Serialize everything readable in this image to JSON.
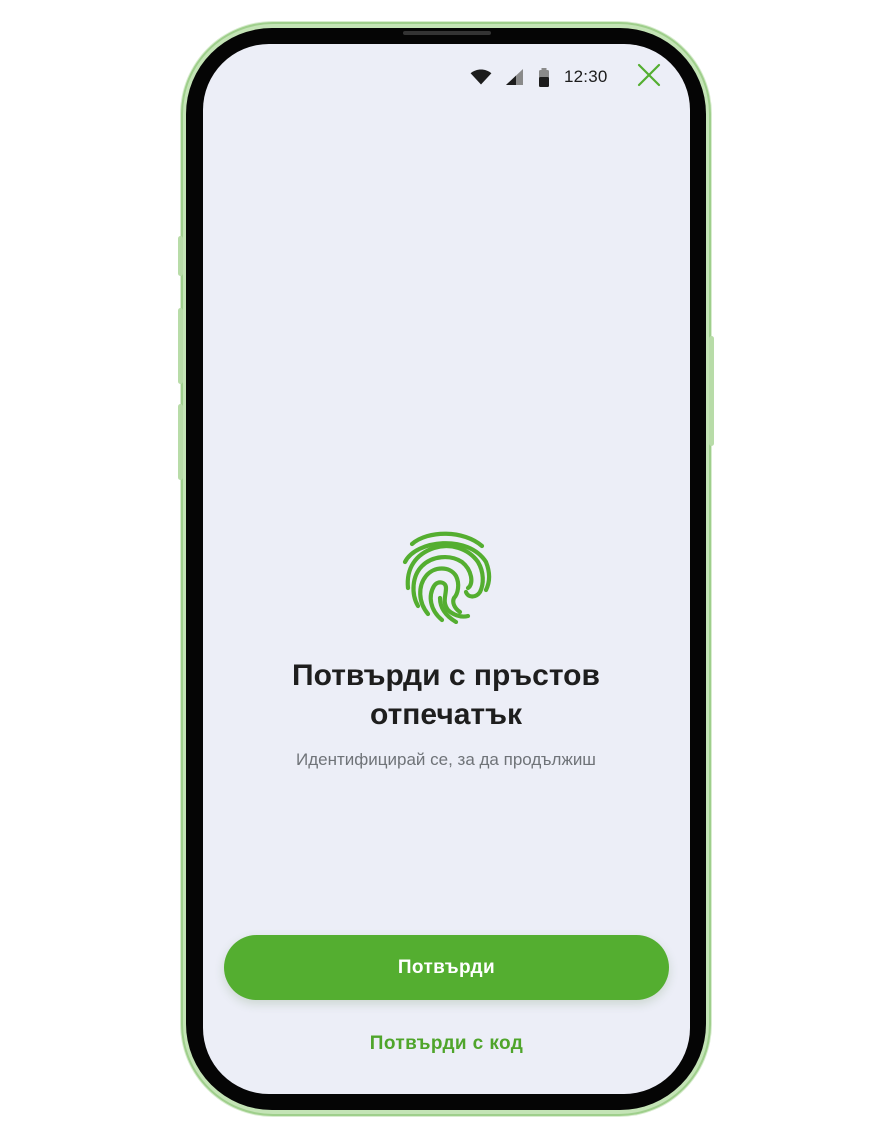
{
  "status_bar": {
    "time": "12:30",
    "wifi_icon": "wifi-icon",
    "signal_icon": "cellular-signal-icon",
    "battery_icon": "battery-icon"
  },
  "header": {
    "close_icon": "close-icon"
  },
  "main": {
    "icon": "fingerprint-icon",
    "title": "Потвърди с пръстов отпечатък",
    "subtitle": "Идентифицирай се, за да продължиш"
  },
  "actions": {
    "confirm_label": "Потвърди",
    "confirm_with_code_label": "Потвърди с код"
  },
  "colors": {
    "accent": "#54ae30",
    "link": "#4fa52b",
    "screen_background": "#eceef7",
    "frame": "#c4e4b6"
  }
}
